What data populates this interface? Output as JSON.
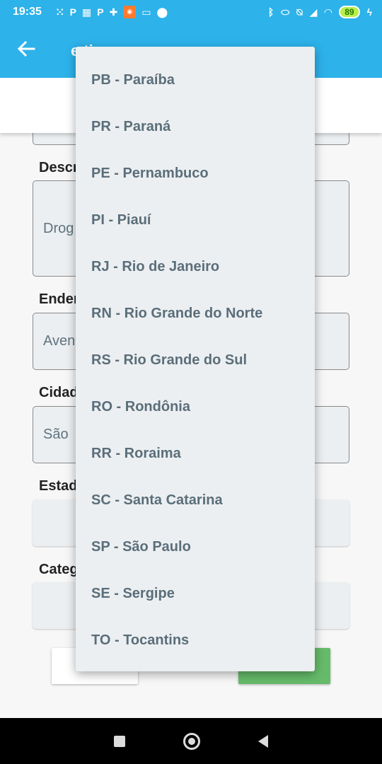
{
  "status_bar": {
    "time": "19:35",
    "battery": "89"
  },
  "app_bar": {
    "title": "e   ti"
  },
  "form": {
    "labels": {
      "descricao": "Descr",
      "endereco": "Ender",
      "cidade": "Cidad",
      "estado": "Estad",
      "categoria": "Categ"
    },
    "values": {
      "descricao": "Drog",
      "endereco": "Aven",
      "cidade": "São"
    }
  },
  "dropdown": {
    "items": [
      "PB - Paraíba",
      "PR - Paraná",
      "PE - Pernambuco",
      "PI - Piauí",
      "RJ - Rio de Janeiro",
      "RN - Rio Grande do Norte",
      "RS - Rio Grande do Sul",
      "RO - Rondônia",
      "RR - Roraima",
      "SC - Santa Catarina",
      "SP - São Paulo",
      "SE - Sergipe",
      "TO - Tocantins"
    ]
  },
  "colors": {
    "primary": "#2db2ea",
    "save_button": "#66bb6a",
    "menu_bg": "#eceff1",
    "menu_text": "#5a6e7a"
  }
}
